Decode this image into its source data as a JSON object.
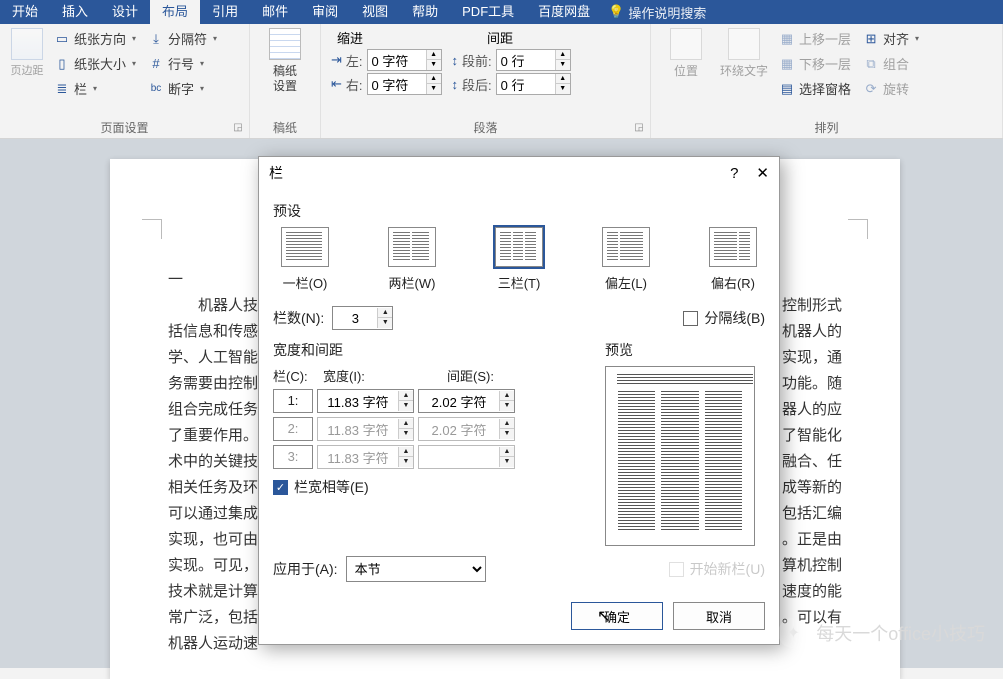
{
  "tabs": {
    "items": [
      "开始",
      "插入",
      "设计",
      "布局",
      "引用",
      "邮件",
      "审阅",
      "视图",
      "帮助",
      "PDF工具",
      "百度网盘"
    ],
    "active": "布局",
    "tellme": "操作说明搜索"
  },
  "ribbon": {
    "page_setup": {
      "margins": "页边距",
      "orientation": "纸张方向",
      "size": "纸张大小",
      "columns": "栏",
      "breaks": "分隔符",
      "line_numbers": "行号",
      "hyphenation": "断字",
      "title": "页面设置"
    },
    "manuscript": {
      "btn": "稿纸\n设置",
      "btn1": "稿纸",
      "btn2": "设置",
      "title": "稿纸"
    },
    "paragraph": {
      "indent_title": "缩进",
      "spacing_title": "间距",
      "left_label": "左:",
      "left_value": "0 字符",
      "right_label": "右:",
      "right_value": "0 字符",
      "before_label": "段前:",
      "before_value": "0 行",
      "after_label": "段后:",
      "after_value": "0 行",
      "title": "段落"
    },
    "arrange": {
      "position": "位置",
      "wrap": "环绕文字",
      "bring_forward": "上移一层",
      "send_backward": "下移一层",
      "selection_pane": "选择窗格",
      "align": "对齐",
      "group": "组合",
      "rotate": "旋转",
      "title": "排列"
    }
  },
  "doc_lines": [
    "一",
    "　　机器人技",
    "括信息和传感",
    "学、人工智能",
    "务需要由控制",
    "组合完成任务",
    "了重要作用。",
    "术中的关键技",
    "相关任务及环",
    "可以通过集成",
    "实现，也可由",
    "实现。可见，",
    "技术就是计算",
    "常广泛，包括",
    "机器人运动速"
  ],
  "doc_lines_right": [
    "",
    "控制形式",
    "机器人的",
    "实现，通",
    "功能。随",
    "器人的应",
    "了智能化",
    "融合、任",
    "成等新的",
    "包括汇编",
    "。正是由",
    "算机控制",
    "速度的能",
    "。可以有",
    ""
  ],
  "dialog": {
    "title": "栏",
    "presets_label": "预设",
    "presets": [
      {
        "key": "one",
        "label": "一栏(O)",
        "cols": 1
      },
      {
        "key": "two",
        "label": "两栏(W)",
        "cols": 2
      },
      {
        "key": "three",
        "label": "三栏(T)",
        "cols": 3
      },
      {
        "key": "left",
        "label": "偏左(L)",
        "cols": 2
      },
      {
        "key": "right",
        "label": "偏右(R)",
        "cols": 2
      }
    ],
    "selected_preset": "three",
    "num_cols_label": "栏数(N):",
    "num_cols_value": "3",
    "divider_label": "分隔线(B)",
    "divider_checked": false,
    "width_spacing_label": "宽度和间距",
    "col_header": "栏(C):",
    "width_header": "宽度(I):",
    "spacing_header": "间距(S):",
    "rows": [
      {
        "idx": "1:",
        "width": "11.83 字符",
        "spacing": "2.02 字符",
        "enabled": true
      },
      {
        "idx": "2:",
        "width": "11.83 字符",
        "spacing": "2.02 字符",
        "enabled": false
      },
      {
        "idx": "3:",
        "width": "11.83 字符",
        "spacing": "",
        "enabled": false
      }
    ],
    "equal_label": "栏宽相等(E)",
    "equal_checked": true,
    "preview_label": "预览",
    "apply_label": "应用于(A):",
    "apply_value": "本节",
    "new_col_label": "开始新栏(U)",
    "new_col_enabled": false,
    "ok": "确定",
    "cancel": "取消"
  },
  "watermark": "每天一个office小技巧"
}
